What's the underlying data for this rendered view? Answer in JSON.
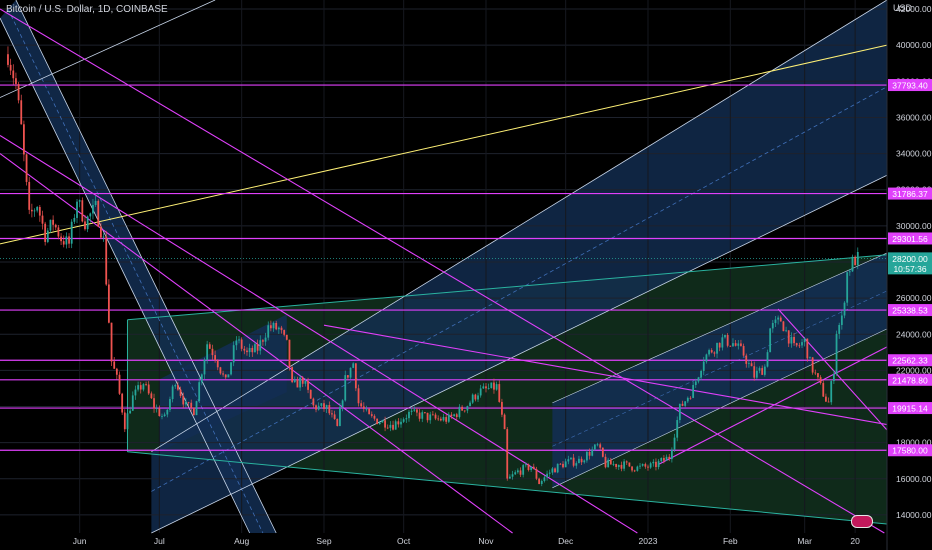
{
  "chart_data": {
    "type": "candlestick",
    "title": "Bitcoin / U.S. Dollar, 1D, COINBASE",
    "currency": "USD",
    "y_ticks": [
      14000,
      16000,
      18000,
      20000,
      22000,
      24000,
      26000,
      28000,
      30000,
      32000,
      34000,
      36000,
      38000,
      40000,
      42000
    ],
    "y_tick_labels": [
      "14000.00",
      "16000.00",
      "18000.00",
      "20000.00",
      "22000.00",
      "24000.00",
      "26000.00",
      "28000.00",
      "30000.00",
      "32000.00",
      "34000.00",
      "36000.00",
      "38000.00",
      "40000.00",
      "42000.00"
    ],
    "ylim": [
      13000,
      42500
    ],
    "x_tick_labels": [
      "Jun",
      "Jul",
      "Aug",
      "Sep",
      "Oct",
      "Nov",
      "Dec",
      "2023",
      "Feb",
      "Mar",
      "20"
    ],
    "x_tick_dates": [
      "2022-06-01",
      "2022-07-01",
      "2022-08-01",
      "2022-09-01",
      "2022-10-01",
      "2022-11-01",
      "2022-12-01",
      "2023-01-01",
      "2023-02-01",
      "2023-03-01",
      "2023-03-20"
    ],
    "xlim": [
      "2022-05-02",
      "2023-04-01"
    ],
    "horizontal_levels": [
      {
        "value": 42600,
        "label": ""
      },
      {
        "value": 37793.4,
        "label": "37793.40"
      },
      {
        "value": 31786.37,
        "label": "31786.37"
      },
      {
        "value": 29301.56,
        "label": "29301.56"
      },
      {
        "value": 25338.53,
        "label": "25338.53"
      },
      {
        "value": 22562.33,
        "label": "22562.33"
      },
      {
        "value": 21478.8,
        "label": "21478.80"
      },
      {
        "value": 19915.14,
        "label": "19915.14"
      },
      {
        "value": 17580.0,
        "label": "17580.00"
      }
    ],
    "last_price": {
      "value": 28200.0,
      "label": "28200.00",
      "countdown": "10:57:36"
    },
    "colors": {
      "background": "#000000",
      "level": "#e040fb",
      "up": "#26a69a",
      "down": "#ef5350",
      "price_badge": "#26a69a",
      "channel_fill": "#132e52",
      "channel_line": "#c8d6ea",
      "trend_yellow": "#fff176",
      "wedge_fill": "#0f2a1a",
      "wedge_line": "#2ab3a0"
    },
    "close_path": [
      [
        "2022-05-05",
        39500
      ],
      [
        "2022-05-08",
        37800
      ],
      [
        "2022-05-10",
        35400
      ],
      [
        "2022-05-13",
        30500
      ],
      [
        "2022-05-16",
        31200
      ],
      [
        "2022-05-19",
        29500
      ],
      [
        "2022-05-22",
        30200
      ],
      [
        "2022-05-25",
        29300
      ],
      [
        "2022-05-28",
        29000
      ],
      [
        "2022-05-31",
        31500
      ],
      [
        "2022-06-03",
        30200
      ],
      [
        "2022-06-07",
        31000
      ],
      [
        "2022-06-10",
        29200
      ],
      [
        "2022-06-13",
        22500
      ],
      [
        "2022-06-15",
        21500
      ],
      [
        "2022-06-18",
        19000
      ],
      [
        "2022-06-21",
        20500
      ],
      [
        "2022-06-25",
        21300
      ],
      [
        "2022-06-29",
        20000
      ],
      [
        "2022-07-03",
        19300
      ],
      [
        "2022-07-07",
        21500
      ],
      [
        "2022-07-11",
        20000
      ],
      [
        "2022-07-14",
        19800
      ],
      [
        "2022-07-19",
        23500
      ],
      [
        "2022-07-22",
        22800
      ],
      [
        "2022-07-26",
        21300
      ],
      [
        "2022-07-30",
        23700
      ],
      [
        "2022-08-03",
        22900
      ],
      [
        "2022-08-07",
        23200
      ],
      [
        "2022-08-11",
        24400
      ],
      [
        "2022-08-15",
        24300
      ],
      [
        "2022-08-18",
        23400
      ],
      [
        "2022-08-20",
        21100
      ],
      [
        "2022-08-24",
        21500
      ],
      [
        "2022-08-28",
        20000
      ],
      [
        "2022-09-02",
        19900
      ],
      [
        "2022-09-06",
        18800
      ],
      [
        "2022-09-09",
        21500
      ],
      [
        "2022-09-12",
        22400
      ],
      [
        "2022-09-14",
        20200
      ],
      [
        "2022-09-18",
        19400
      ],
      [
        "2022-09-22",
        19200
      ],
      [
        "2022-09-27",
        19000
      ],
      [
        "2022-10-03",
        19600
      ],
      [
        "2022-10-08",
        19500
      ],
      [
        "2022-10-13",
        19300
      ],
      [
        "2022-10-18",
        19300
      ],
      [
        "2022-10-25",
        20100
      ],
      [
        "2022-10-29",
        20800
      ],
      [
        "2022-11-05",
        21100
      ],
      [
        "2022-11-08",
        18500
      ],
      [
        "2022-11-09",
        15900
      ],
      [
        "2022-11-13",
        16400
      ],
      [
        "2022-11-18",
        16700
      ],
      [
        "2022-11-21",
        15800
      ],
      [
        "2022-11-26",
        16500
      ],
      [
        "2022-12-01",
        16900
      ],
      [
        "2022-12-06",
        17000
      ],
      [
        "2022-12-13",
        17800
      ],
      [
        "2022-12-16",
        16800
      ],
      [
        "2022-12-22",
        16800
      ],
      [
        "2022-12-28",
        16600
      ],
      [
        "2023-01-03",
        16700
      ],
      [
        "2023-01-09",
        17200
      ],
      [
        "2023-01-13",
        19900
      ],
      [
        "2023-01-18",
        21000
      ],
      [
        "2023-01-22",
        22700
      ],
      [
        "2023-01-29",
        23700
      ],
      [
        "2023-02-02",
        23500
      ],
      [
        "2023-02-06",
        22900
      ],
      [
        "2023-02-10",
        21700
      ],
      [
        "2023-02-14",
        22200
      ],
      [
        "2023-02-16",
        24300
      ],
      [
        "2023-02-20",
        24800
      ],
      [
        "2023-02-25",
        23200
      ],
      [
        "2023-03-01",
        23600
      ],
      [
        "2023-03-03",
        22400
      ],
      [
        "2023-03-09",
        20400
      ],
      [
        "2023-03-10",
        20200
      ],
      [
        "2023-03-12",
        22100
      ],
      [
        "2023-03-13",
        24200
      ],
      [
        "2023-03-15",
        24800
      ],
      [
        "2023-03-17",
        27400
      ],
      [
        "2023-03-19",
        28000
      ],
      [
        "2023-03-21",
        28200
      ]
    ]
  }
}
